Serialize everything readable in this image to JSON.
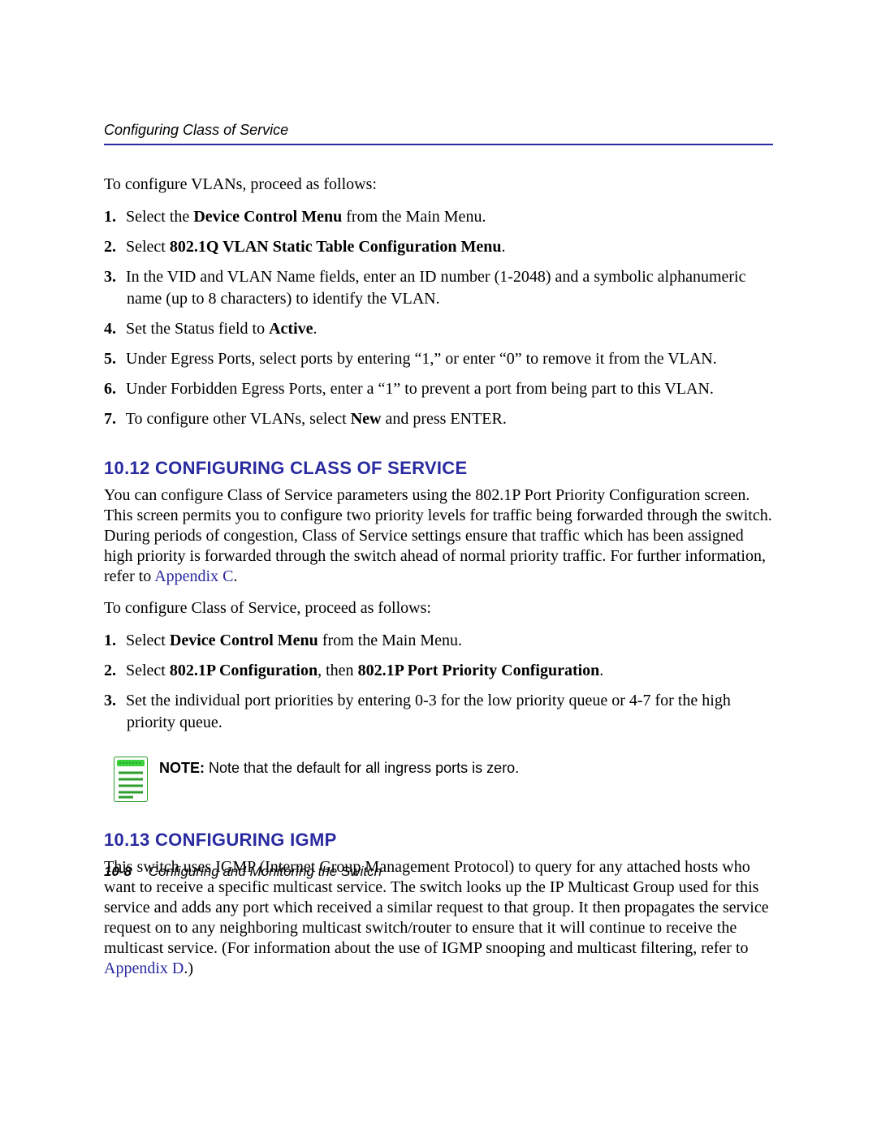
{
  "header": {
    "running_title": "Configuring Class of Service"
  },
  "intro_vlan": "To configure VLANs, proceed as follows:",
  "vlan_steps": [
    {
      "n": "1.",
      "pre": "Select the ",
      "b1": "Device Control Menu",
      "post": " from the Main Menu."
    },
    {
      "n": "2.",
      "pre": "Select ",
      "b1": "802.1Q VLAN Static Table Configuration Menu",
      "post": "."
    },
    {
      "n": "3.",
      "pre": "In the VID and VLAN Name fields, enter an ID number (1-2048) and a symbolic alphanumeric name (up to 8 characters) to identify the VLAN.",
      "b1": "",
      "post": ""
    },
    {
      "n": "4.",
      "pre": "Set the Status field to ",
      "b1": "Active",
      "post": "."
    },
    {
      "n": "5.",
      "pre": "Under Egress Ports, select ports by entering “1,” or enter “0” to remove it from the VLAN.",
      "b1": "",
      "post": ""
    },
    {
      "n": "6.",
      "pre": "Under Forbidden Egress Ports, enter a “1” to prevent a port from being part to this VLAN.",
      "b1": "",
      "post": ""
    },
    {
      "n": "7.",
      "pre": "To configure other VLANs, select ",
      "b1": "New",
      "post": " and press ENTER."
    }
  ],
  "section_cos": {
    "heading": "10.12 CONFIGURING CLASS OF SERVICE",
    "body_pre": "You can configure Class of Service parameters using the 802.1P Port Priority Configuration screen. This screen permits you to configure two priority levels for traffic being forwarded through the switch. During periods of congestion, Class of Service settings ensure that traffic which has been assigned high priority is forwarded through the switch ahead of normal priority traffic. For further information, refer to ",
    "body_link": "Appendix C",
    "body_post": ".",
    "intro": "To configure Class of Service, proceed as follows:",
    "steps": [
      {
        "n": "1.",
        "pre": "Select ",
        "b1": "Device Control Menu",
        "post": " from the Main Menu."
      },
      {
        "n": "2.",
        "pre": "Select ",
        "b1": "802.1P Configuration",
        "mid": ", then ",
        "b2": "802.1P Port Priority Configuration",
        "post": "."
      },
      {
        "n": "3.",
        "pre": "Set the individual port priorities by entering 0-3 for the low priority queue or 4-7 for the high priority queue.",
        "b1": "",
        "post": ""
      }
    ],
    "note_label": "NOTE:",
    "note_text": "  Note that the default for all ingress ports is zero."
  },
  "section_igmp": {
    "heading": "10.13 CONFIGURING IGMP",
    "body_pre": "This switch uses IGMP (Internet Group Management Protocol) to query for any attached hosts who want to receive a specific multicast service. The switch looks up the IP Multicast Group used for this service and adds any port which received a similar request to that group. It then propagates the service request on to any neighboring multicast switch/router to ensure that it will continue to receive the multicast service. (For information about the use of IGMP snooping and multicast filtering, refer to ",
    "body_link": "Appendix D",
    "body_post": ".)"
  },
  "footer": {
    "page_number": "10-8",
    "chapter_title": "Configuring and Monitoring the Switch"
  }
}
